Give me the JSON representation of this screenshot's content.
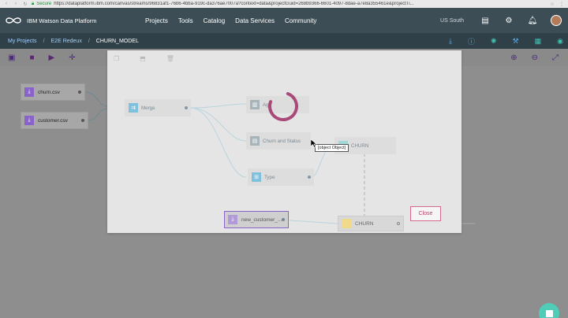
{
  "browser": {
    "secure_label": "Secure",
    "url": "https://dataplatform.ibm.com/canvas/streams/96831af1-76b6-4bba-919c-da376ae7007a?context=data&projectGuid=268b9366-6601-4097-8dae-a7e8a355461e&projectTi..."
  },
  "header": {
    "brand": "IBM Watson Data Platform",
    "menu": [
      "Projects",
      "Tools",
      "Catalog",
      "Data Services",
      "Community"
    ],
    "region": "US South"
  },
  "breadcrumb": {
    "project_link": "My Projects",
    "stream_link": "E2E Redeux",
    "current": "CHURN_MODEL"
  },
  "canvas": {
    "nodes": {
      "churn_csv": "churn.csv",
      "customer_csv": "customer.csv"
    }
  },
  "modal": {
    "nodes": {
      "merge": "Merge",
      "agg": "Ag",
      "churn_status": "Churn and Status",
      "churn_top": "CHURN",
      "type": "Type",
      "new_customer": "new_customer_...",
      "churn_bottom": "CHURN"
    },
    "tooltip": "[object Object]",
    "close_label": "Close"
  },
  "colors": {
    "header_bg": "#3d4d55",
    "accent_purple": "#9b3a6e",
    "spinner": "#a8497a",
    "help_bubble": "#4fcdb9"
  }
}
